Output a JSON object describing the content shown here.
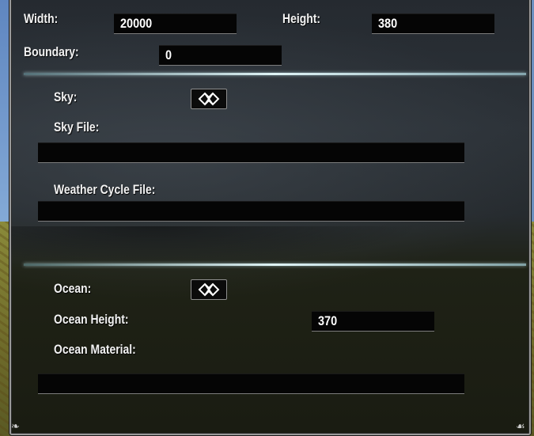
{
  "labels": {
    "width": "Width:",
    "height": "Height:",
    "boundary": "Boundary:",
    "sky": "Sky:",
    "sky_file": "Sky File:",
    "weather_cycle_file": "Weather Cycle File:",
    "ocean": "Ocean:",
    "ocean_height": "Ocean Height:",
    "ocean_material": "Ocean Material:"
  },
  "values": {
    "width": "20000",
    "height": "380",
    "boundary": "0",
    "sky_file": "",
    "weather_cycle_file": "",
    "ocean_height": "370",
    "ocean_material": ""
  },
  "toggles": {
    "sky_checked": true,
    "ocean_checked": true
  },
  "icons": {
    "checkbox_mark": "diamond-lattice-icon",
    "corner_bottom_left": "corner-ornament-icon",
    "corner_bottom_right": "corner-ornament-icon"
  },
  "colors": {
    "panel_background": "#262b30",
    "field_background": "#050505",
    "divider": "#dff4f6",
    "text": "#f2f2f2"
  }
}
